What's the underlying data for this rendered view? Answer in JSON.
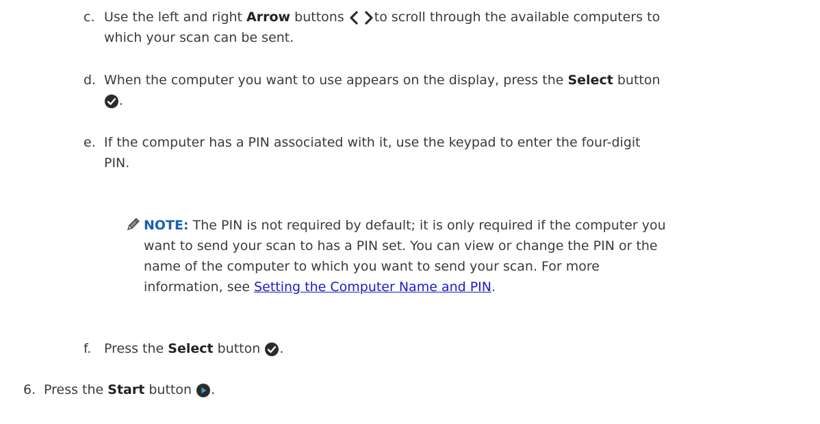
{
  "steps": {
    "c": {
      "marker": "c.",
      "t1": "Use the left and right ",
      "b1": "Arrow",
      "t2": " buttons ",
      "t3": "to scroll through the available computers to",
      "line2": "which your scan can be sent."
    },
    "d": {
      "marker": "d.",
      "line1": "When the computer you want to use appears on the display, press the ",
      "b1": "Select",
      "t2": " button",
      "t3": "."
    },
    "e": {
      "marker": "e.",
      "line1": "If the computer has a PIN associated with it, use the keypad to enter the four-digit",
      "line2": "PIN."
    },
    "note": {
      "label": "NOTE:",
      "line1": " The PIN is not required by default; it is only required if the computer you",
      "line2": "want to send your scan to has a PIN set. You can view or change the PIN or the",
      "line3": "name of the computer to which you want to send your scan. For more",
      "line4a": "information, see ",
      "link": "Setting the Computer Name and PIN",
      "line4b": "."
    },
    "f": {
      "marker": "f.",
      "t1": "Press the ",
      "b1": "Select",
      "t2": " button ",
      "t3": "."
    },
    "six": {
      "marker": "6.",
      "t1": "Press the ",
      "b1": "Start",
      "t2": " button ",
      "t3": "."
    }
  },
  "icons": {
    "arrows": "left-right-arrow-icon",
    "select": "checkmark-select-icon",
    "start": "start-play-icon",
    "note": "pencil-note-icon"
  },
  "colors": {
    "text": "#3a3a3a",
    "note_label": "#1a5fb4",
    "link": "#1a1acc",
    "icon_fill": "#2b2b2b"
  }
}
